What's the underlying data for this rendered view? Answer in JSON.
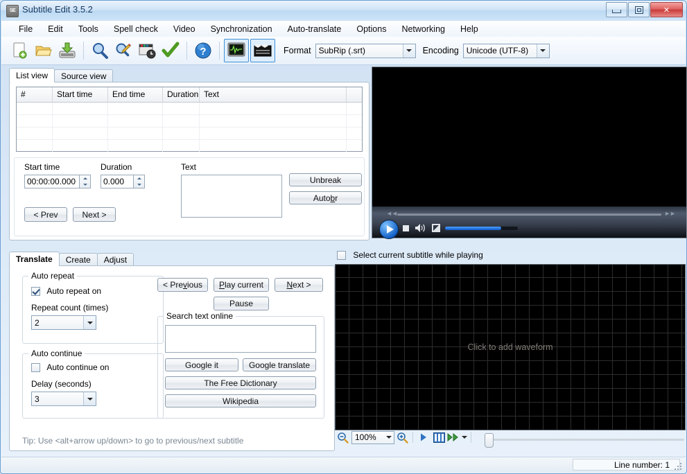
{
  "window": {
    "title": "Subtitle Edit 3.5.2",
    "icon": "app-icon",
    "minimize_label": "Minimize",
    "restore_label": "Restore",
    "close_label": "Close"
  },
  "menu": {
    "items": [
      {
        "label": "File"
      },
      {
        "label": "Edit"
      },
      {
        "label": "Tools"
      },
      {
        "label": "Spell check"
      },
      {
        "label": "Video"
      },
      {
        "label": "Synchronization"
      },
      {
        "label": "Auto-translate"
      },
      {
        "label": "Options"
      },
      {
        "label": "Networking"
      },
      {
        "label": "Help"
      }
    ]
  },
  "toolbar": {
    "buttons": [
      {
        "name": "new-file-icon"
      },
      {
        "name": "open-file-icon"
      },
      {
        "name": "save-file-icon"
      },
      {
        "name": "find-icon"
      },
      {
        "name": "replace-icon"
      },
      {
        "name": "sync-icon"
      },
      {
        "name": "spell-check-icon"
      },
      {
        "name": "help-icon"
      }
    ],
    "toggle_waveform": "waveform-toggle-icon",
    "toggle_video": "video-toggle-icon",
    "format_label": "Format",
    "format_value": "SubRip (.srt)",
    "encoding_label": "Encoding",
    "encoding_value": "Unicode (UTF-8)"
  },
  "listview": {
    "tabs": [
      {
        "label": "List view",
        "active": true
      },
      {
        "label": "Source view",
        "active": false
      }
    ],
    "columns": [
      "#",
      "Start time",
      "End time",
      "Duration",
      "Text",
      ""
    ],
    "rows": []
  },
  "editor": {
    "start_time_label": "Start time",
    "start_time_value": "00:00:00.000",
    "duration_label": "Duration",
    "duration_value": "0.000",
    "text_label": "Text",
    "text_value": "",
    "unbreak_label": "Unbreak",
    "autobr_label_before": "Auto ",
    "autobr_label_accel": "b",
    "autobr_label_after": "r",
    "prev_label": "< Prev",
    "next_label": "Next >"
  },
  "video": {
    "play_label": "Play",
    "stop_label": "Stop",
    "mute_label": "Mute",
    "fullscreen_label": "Full screen",
    "volume_percent": 77
  },
  "translate": {
    "tabs": [
      {
        "label": "Translate",
        "active": true
      },
      {
        "label": "Create",
        "active": false
      },
      {
        "label": "Adjust",
        "active": false
      }
    ],
    "auto_repeat": {
      "group_label": "Auto repeat",
      "checkbox_label": "Auto repeat on",
      "checked": true,
      "count_label": "Repeat count (times)",
      "count_value": "2"
    },
    "auto_continue": {
      "group_label": "Auto continue",
      "checkbox_label": "Auto continue on",
      "checked": false,
      "delay_label": "Delay (seconds)",
      "delay_value": "3"
    },
    "previous_label_before": "< Pre",
    "previous_label_accel": "v",
    "previous_label_after": "ious",
    "play_current_accel": "P",
    "play_current_after": "lay current",
    "next_accel": "N",
    "next_after": "ext >",
    "pause_label": "Pause",
    "search_group_label": "Search text online",
    "search_value": "",
    "google_it_label": "Google it",
    "google_translate_label": "Google translate",
    "free_dictionary_label": "The Free Dictionary",
    "wikipedia_label": "Wikipedia",
    "tip": "Tip: Use <alt+arrow up/down> to go to previous/next subtitle"
  },
  "waveform": {
    "select_subtitle_label": "Select current subtitle while playing",
    "select_subtitle_checked": false,
    "placeholder": "Click to add waveform",
    "zoom_value": "100%",
    "zoom_out_icon": "zoom-out-icon",
    "zoom_in_icon": "zoom-in-icon",
    "play_icon": "play-icon",
    "frames_icon": "video-frames-icon",
    "forward_icon": "fast-forward-icon"
  },
  "statusbar": {
    "line_number": "Line number: 1"
  },
  "colors": {
    "accent": "#3c8fd6",
    "title_text": "#15385f",
    "close_button": "#c93b39",
    "waveform_bg": "#000000"
  }
}
